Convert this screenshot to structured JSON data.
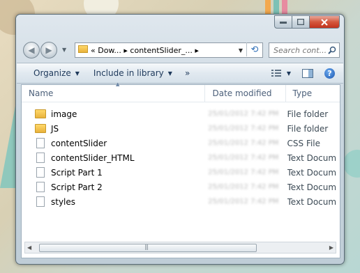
{
  "window": {
    "controls": [
      "minimize",
      "maximize",
      "close"
    ]
  },
  "address_bar": {
    "path_text": "« Dow... ▸ contentSlider_... ▸"
  },
  "search": {
    "placeholder": "Search cont..."
  },
  "toolbar": {
    "organize": "Organize",
    "include_in_library": "Include in library",
    "more": "»"
  },
  "columns": {
    "name": "Name",
    "date_modified": "Date modified",
    "type": "Type"
  },
  "files": [
    {
      "name": "image",
      "date": "25/01/2012 7:42 PM",
      "type": "File folder",
      "icon": "folder-icon"
    },
    {
      "name": "JS",
      "date": "25/01/2012 7:42 PM",
      "type": "File folder",
      "icon": "folder-icon"
    },
    {
      "name": "contentSlider",
      "date": "25/01/2012 7:42 PM",
      "type": "CSS File",
      "icon": "document-icon"
    },
    {
      "name": "contentSlider_HTML",
      "date": "25/01/2012 7:42 PM",
      "type": "Text Docum",
      "icon": "document-icon"
    },
    {
      "name": "Script Part 1",
      "date": "25/01/2012 7:42 PM",
      "type": "Text Docum",
      "icon": "document-icon"
    },
    {
      "name": "Script Part 2",
      "date": "25/01/2012 7:42 PM",
      "type": "Text Docum",
      "icon": "document-icon"
    },
    {
      "name": "styles",
      "date": "25/01/2012 7:42 PM",
      "type": "Text Docum",
      "icon": "document-icon"
    }
  ]
}
